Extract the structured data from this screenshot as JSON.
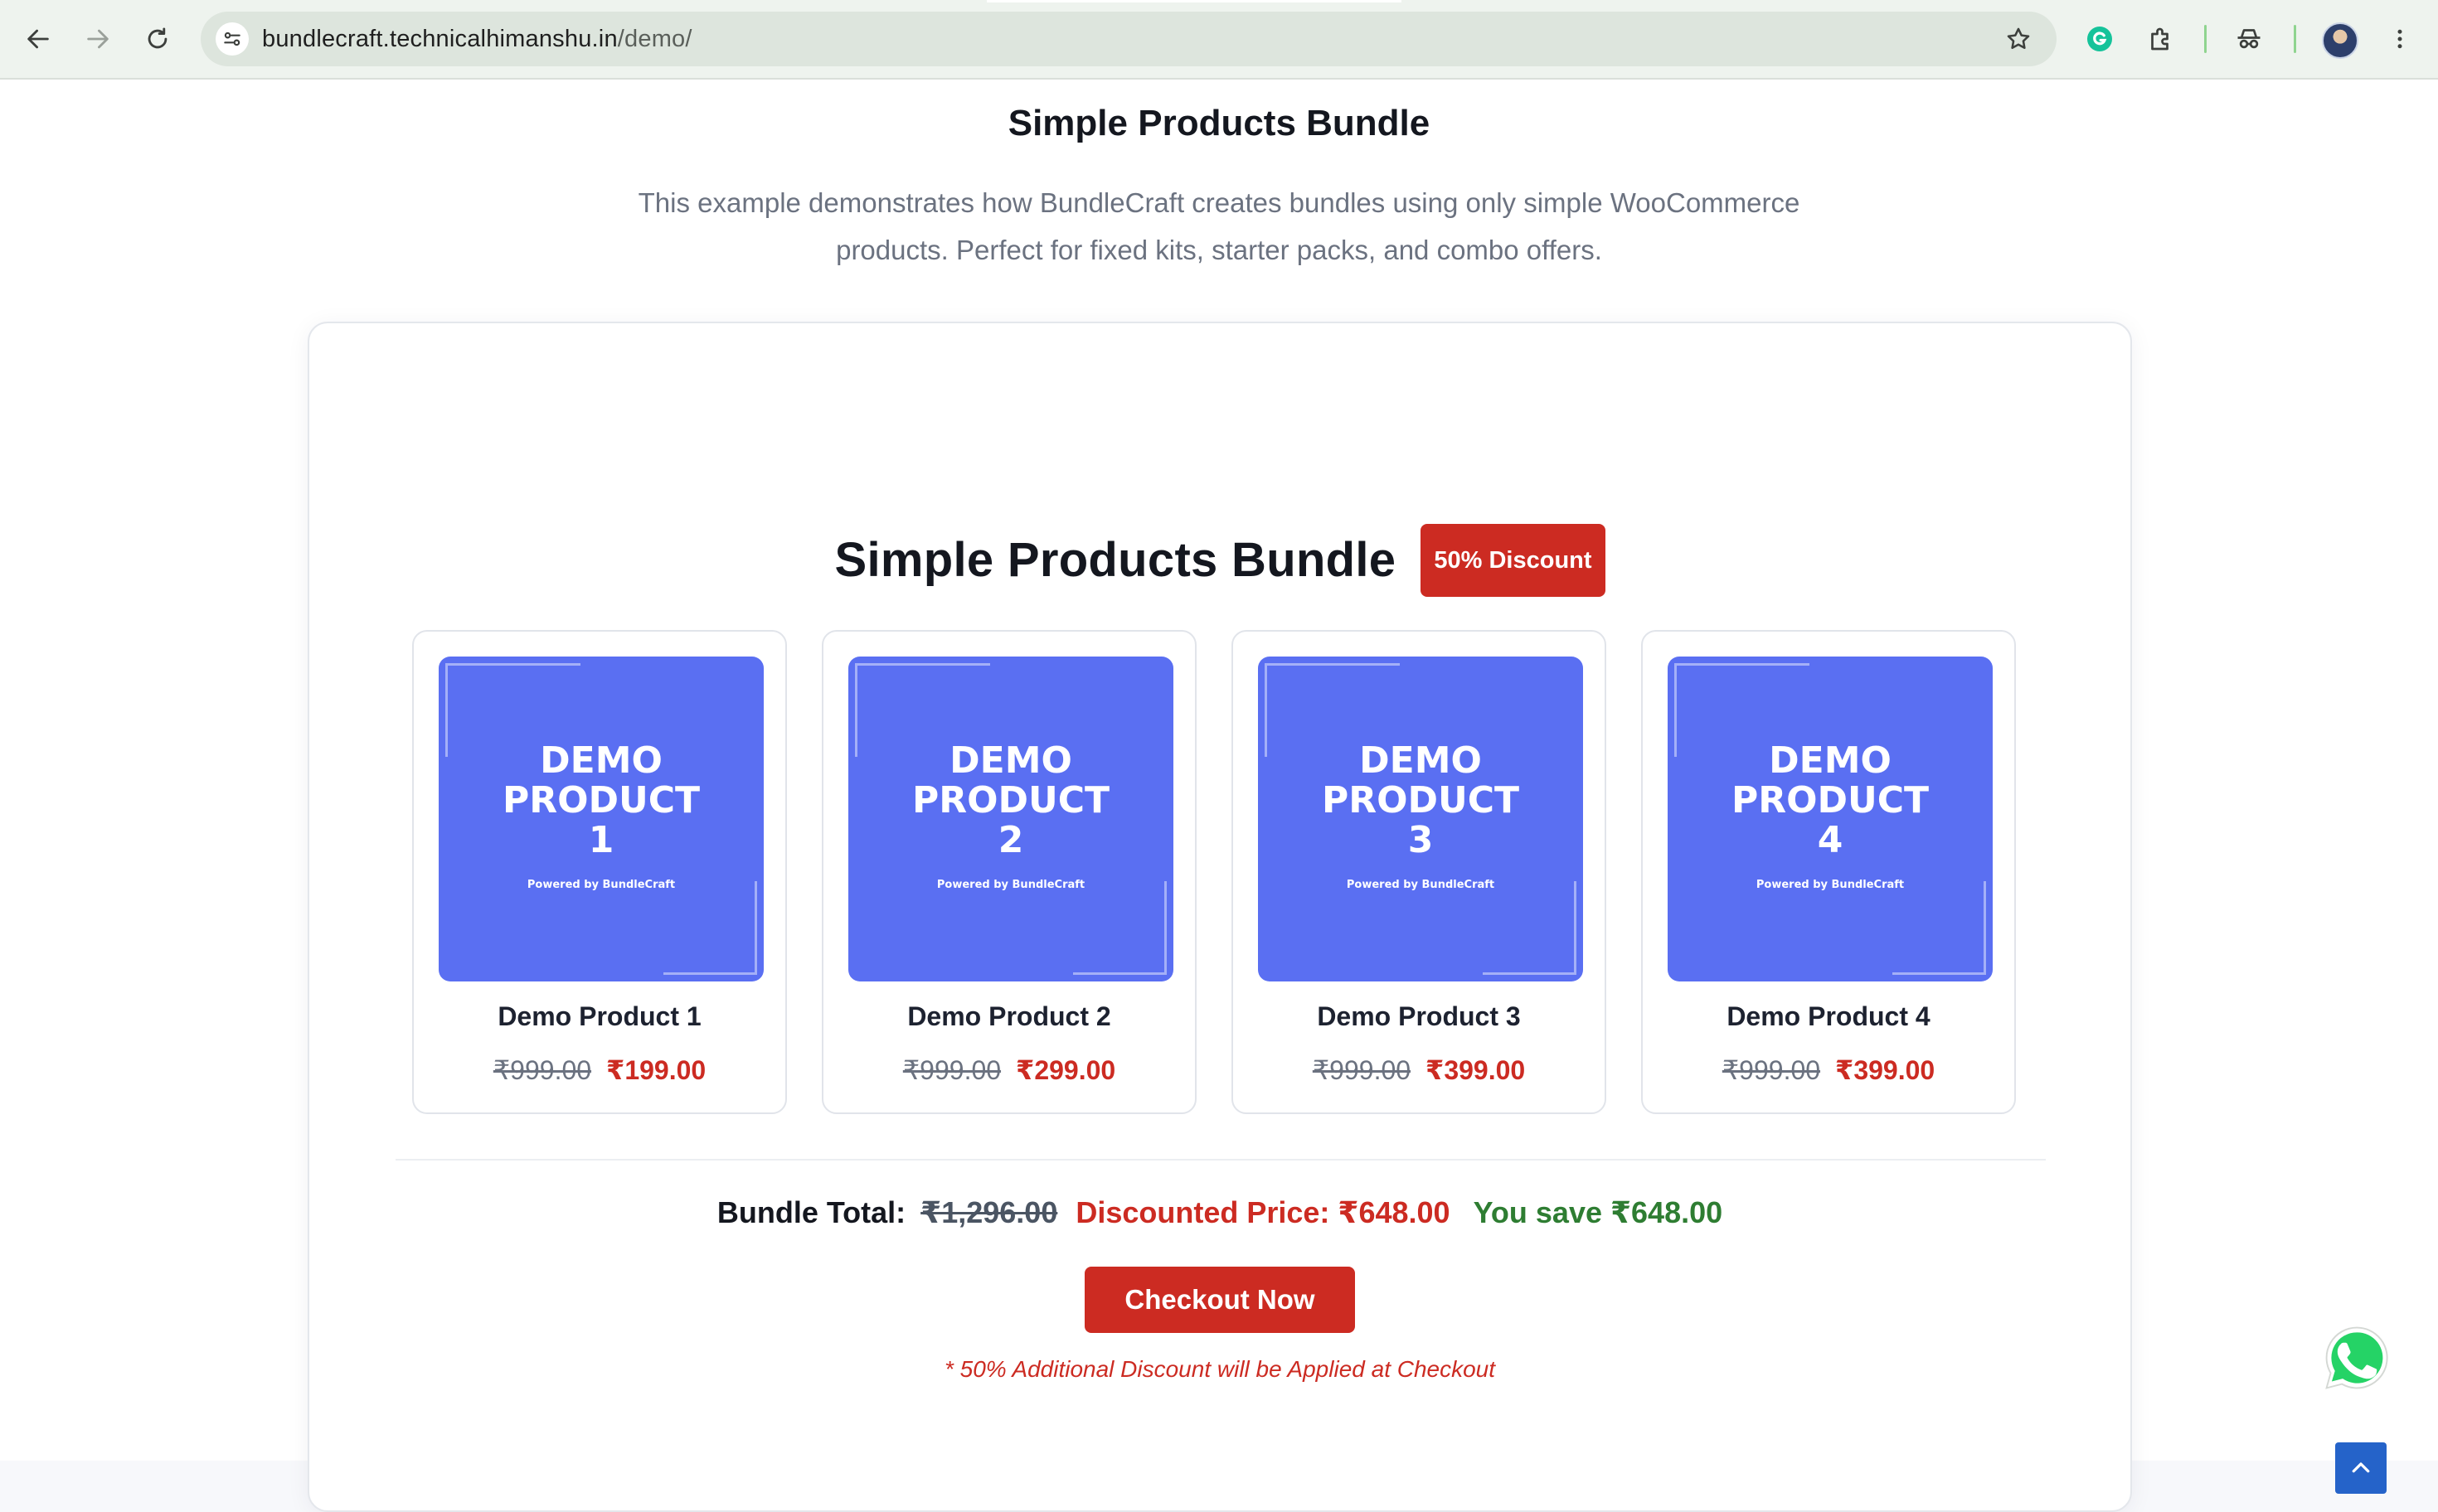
{
  "browser": {
    "url_host": "bundlecraft.technicalhimanshu.in",
    "url_path": "/demo/"
  },
  "page": {
    "heading": "Simple Products Bundle",
    "description": "This example demonstrates how BundleCraft creates bundles using only simple WooCommerce products. Perfect for fixed kits, starter packs, and combo offers."
  },
  "bundle": {
    "title": "Simple Products Bundle",
    "badge": "50% Discount",
    "products": [
      {
        "image_title": "DEMO\nPRODUCT\n1",
        "image_sub": "Powered by BundleCraft",
        "name": "Demo Product 1",
        "old_price": "₹999.00",
        "new_price": "₹199.00"
      },
      {
        "image_title": "DEMO\nPRODUCT\n2",
        "image_sub": "Powered by BundleCraft",
        "name": "Demo Product 2",
        "old_price": "₹999.00",
        "new_price": "₹299.00"
      },
      {
        "image_title": "DEMO\nPRODUCT\n3",
        "image_sub": "Powered by BundleCraft",
        "name": "Demo Product 3",
        "old_price": "₹999.00",
        "new_price": "₹399.00"
      },
      {
        "image_title": "DEMO\nPRODUCT\n4",
        "image_sub": "Powered by BundleCraft",
        "name": "Demo Product 4",
        "old_price": "₹999.00",
        "new_price": "₹399.00"
      }
    ],
    "total_label": "Bundle Total:",
    "total_original": "₹1,296.00",
    "discounted_price": "Discounted Price: ₹648.00",
    "savings": "You save ₹648.00",
    "checkout_label": "Checkout Now",
    "note": "* 50% Additional Discount will be Applied at Checkout"
  },
  "colors": {
    "accent_red": "#cc2b22",
    "product_image_bg": "#5a6ff2",
    "savings_green": "#2e7d32",
    "scroll_top_blue": "#2563c9"
  }
}
